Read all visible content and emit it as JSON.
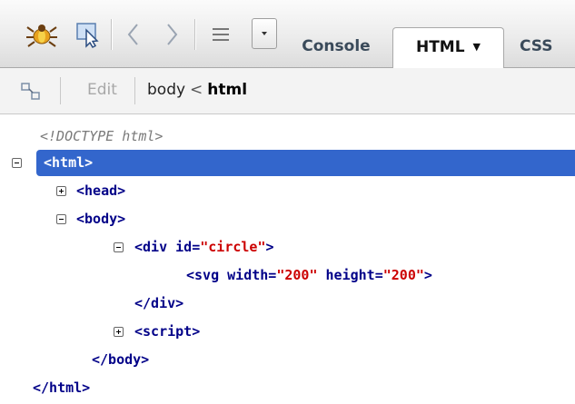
{
  "toolbar": {
    "icons": [
      "firebug-icon",
      "inspect-cursor-icon",
      "back-icon",
      "forward-icon",
      "menu-icon",
      "dropdown-arrow-icon"
    ],
    "tabs": [
      {
        "label": "Console",
        "active": false
      },
      {
        "label": "HTML",
        "active": true,
        "caret": "▼"
      },
      {
        "label": "CSS",
        "active": false
      }
    ]
  },
  "crumbbar": {
    "edit_label": "Edit",
    "path_parent": "body",
    "path_sep": "<",
    "path_current": "html"
  },
  "tree": {
    "doctype": "<!DOCTYPE html>",
    "html_open": "<html>",
    "head": "<head>",
    "body_open": "<body>",
    "div_open_prefix": "<div ",
    "div_attr": "id=",
    "div_attr_value": "\"circle\"",
    "div_close_bracket": ">",
    "svg_prefix": "<svg ",
    "svg_attr1": "width=",
    "svg_val1": "\"200\"",
    "svg_attr2": " height=",
    "svg_val2": "\"200\"",
    "svg_close_bracket": ">",
    "div_close": "</div>",
    "script": "<script>",
    "body_close": "</body>",
    "html_close": "</html>"
  },
  "colors": {
    "selection": "#3366cc",
    "tag": "#000088",
    "attr_value": "#cc0000",
    "doctype": "#7a7a7a"
  }
}
